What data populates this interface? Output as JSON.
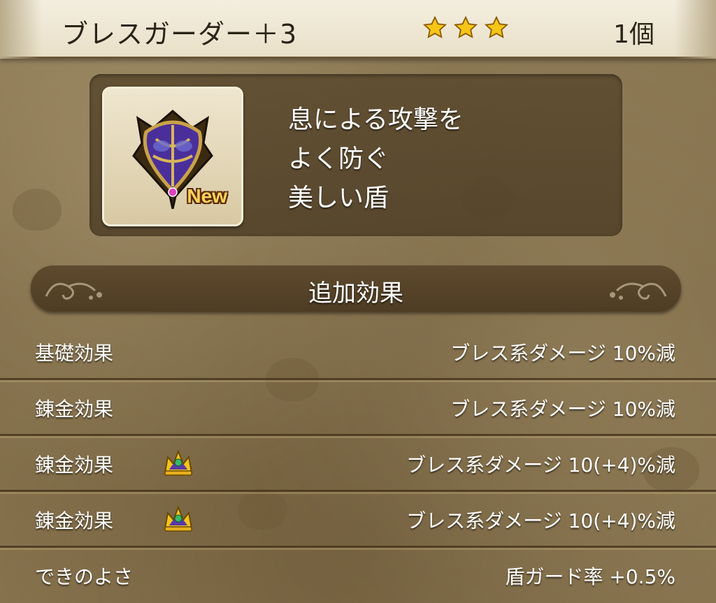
{
  "header": {
    "item_name": "ブレスガーダー＋3",
    "star_count": 3,
    "count": "1個"
  },
  "item": {
    "icon": "shield-icon",
    "new_badge": "New",
    "description_lines": [
      "息による攻撃を",
      "よく防ぐ",
      "美しい盾"
    ]
  },
  "section": {
    "title": "追加効果"
  },
  "effects": [
    {
      "label": "基礎効果",
      "value": "ブレス系ダメージ  10%減",
      "crown": false
    },
    {
      "label": "錬金効果",
      "value": "ブレス系ダメージ  10%減",
      "crown": false
    },
    {
      "label": "錬金効果",
      "value": "ブレス系ダメージ  10(+4)%減",
      "crown": true
    },
    {
      "label": "錬金効果",
      "value": "ブレス系ダメージ  10(+4)%減",
      "crown": true
    },
    {
      "label": "できのよさ",
      "value": "盾ガード率  +0.5%",
      "crown": false
    }
  ],
  "colors": {
    "star": "#f5c518",
    "header_bg": "#f0e9d6",
    "panel_bg": "#5a482d",
    "text_light": "#ffffff",
    "text_dark": "#2a2418"
  }
}
